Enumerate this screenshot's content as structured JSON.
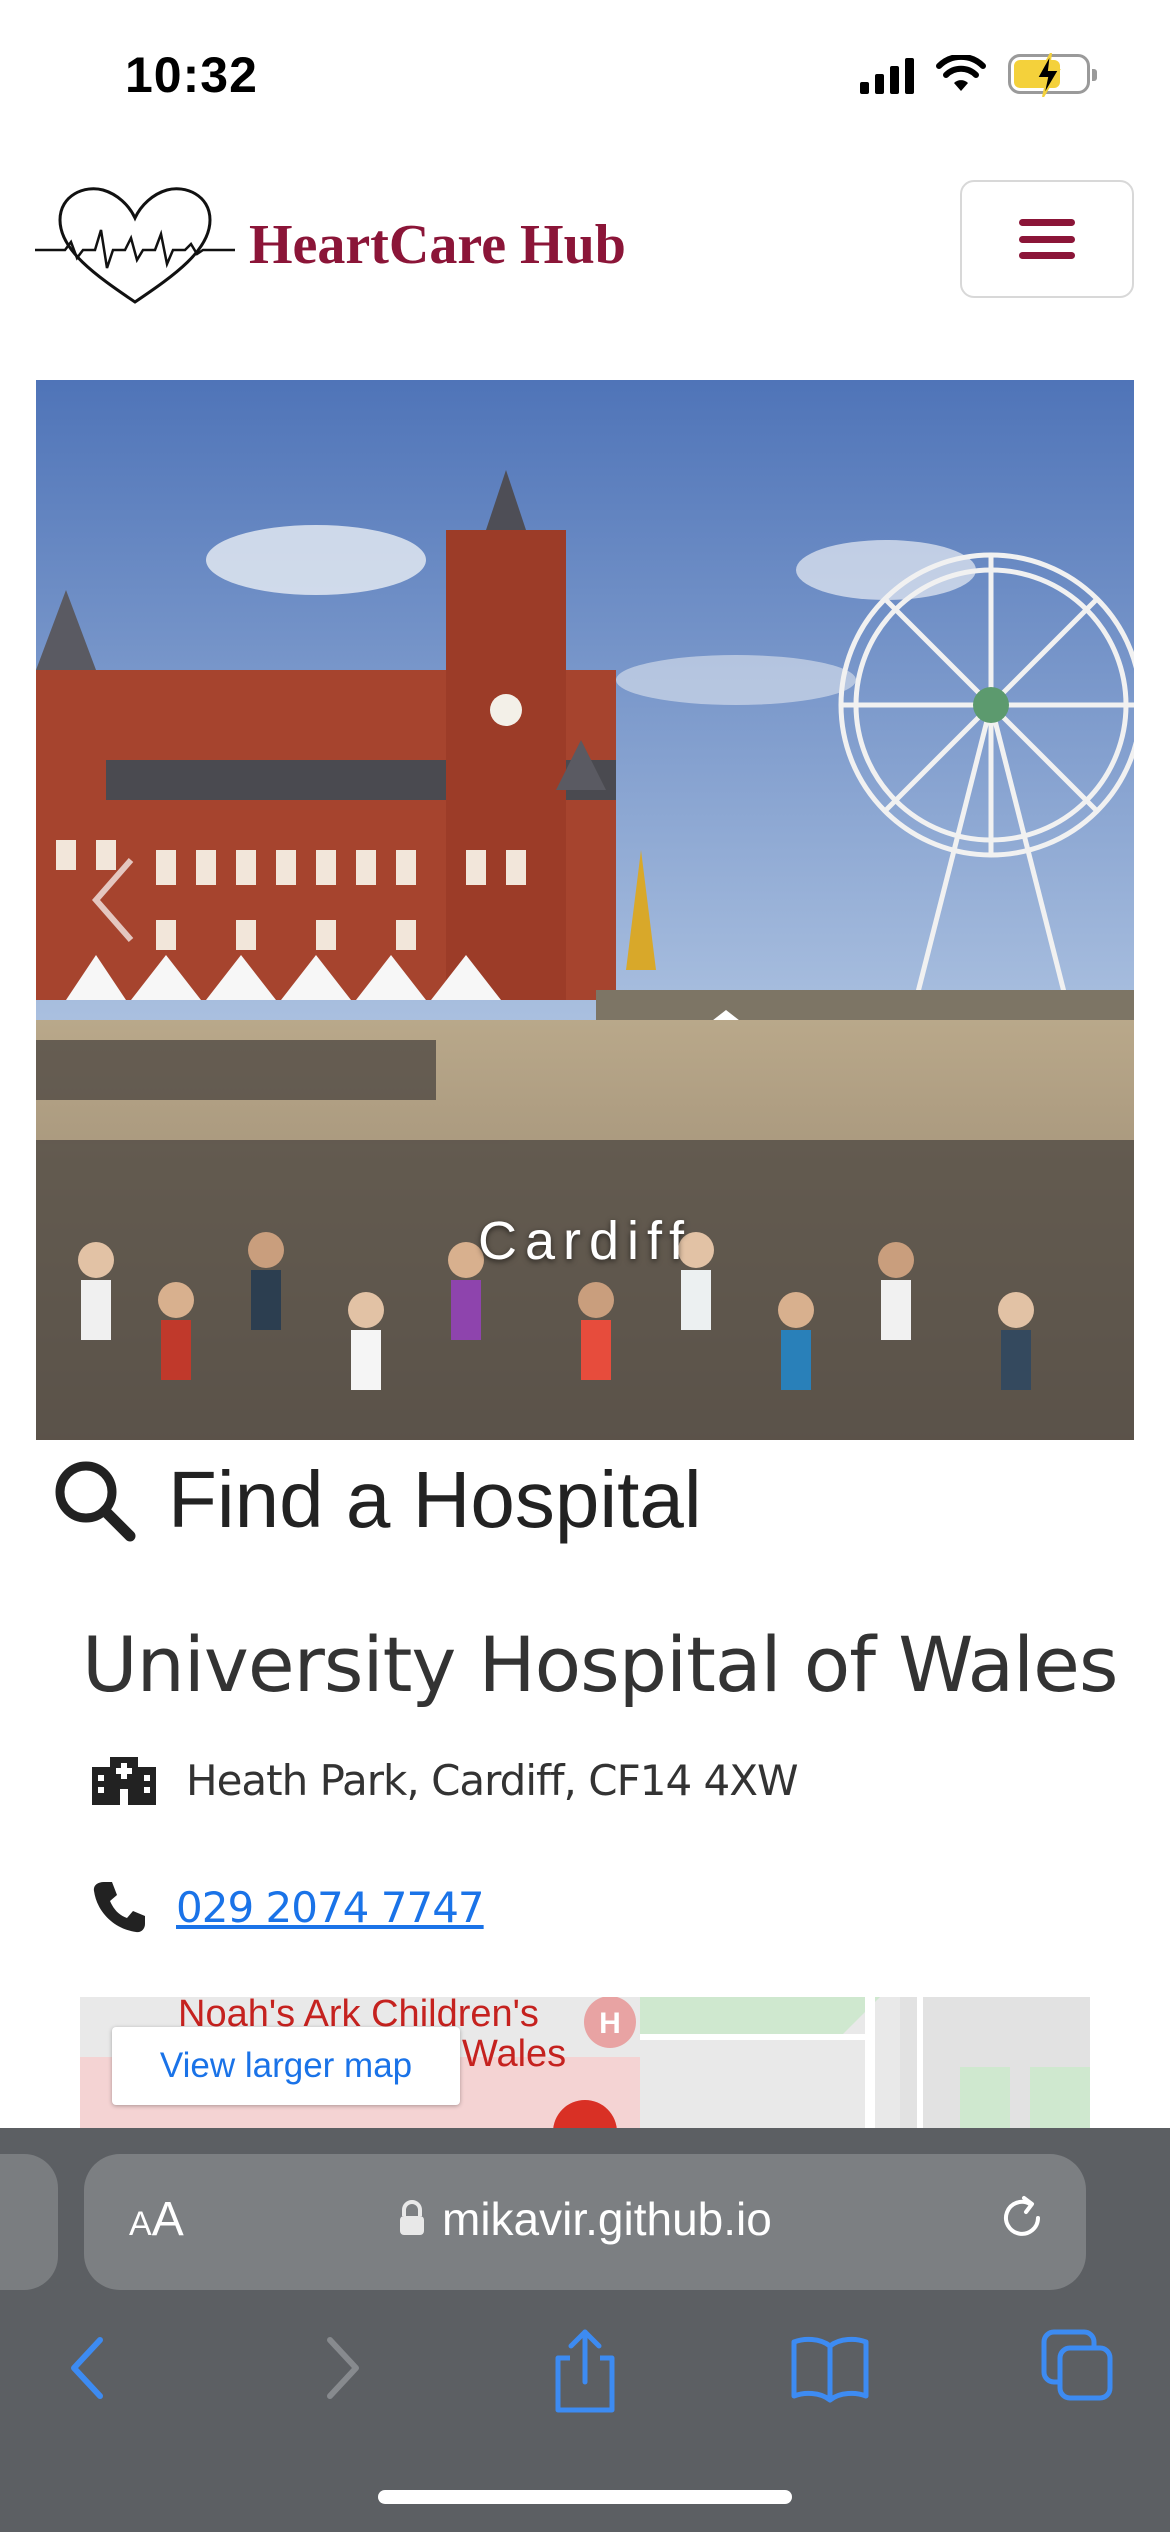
{
  "status_bar": {
    "time": "10:32"
  },
  "header": {
    "brand_name": "HeartCare Hub"
  },
  "carousel": {
    "caption": "Cardiff"
  },
  "find_hospital": {
    "title": "Find a Hospital"
  },
  "hospital": {
    "name": "University Hospital of Wales",
    "address": "Heath Park, Cardiff, CF14 4XW",
    "phone": "029 2074 7747"
  },
  "map": {
    "button_label": "View larger map",
    "place_label_line1": "Noah's Ark Children's",
    "place_label_line2": "Wales"
  },
  "browser": {
    "text_size_label_small": "A",
    "text_size_label_large": "A",
    "url": "mikavir.github.io"
  },
  "colors": {
    "brand": "#8b1538",
    "link": "#1a73e8",
    "safari_bar": "#5c5f63"
  }
}
